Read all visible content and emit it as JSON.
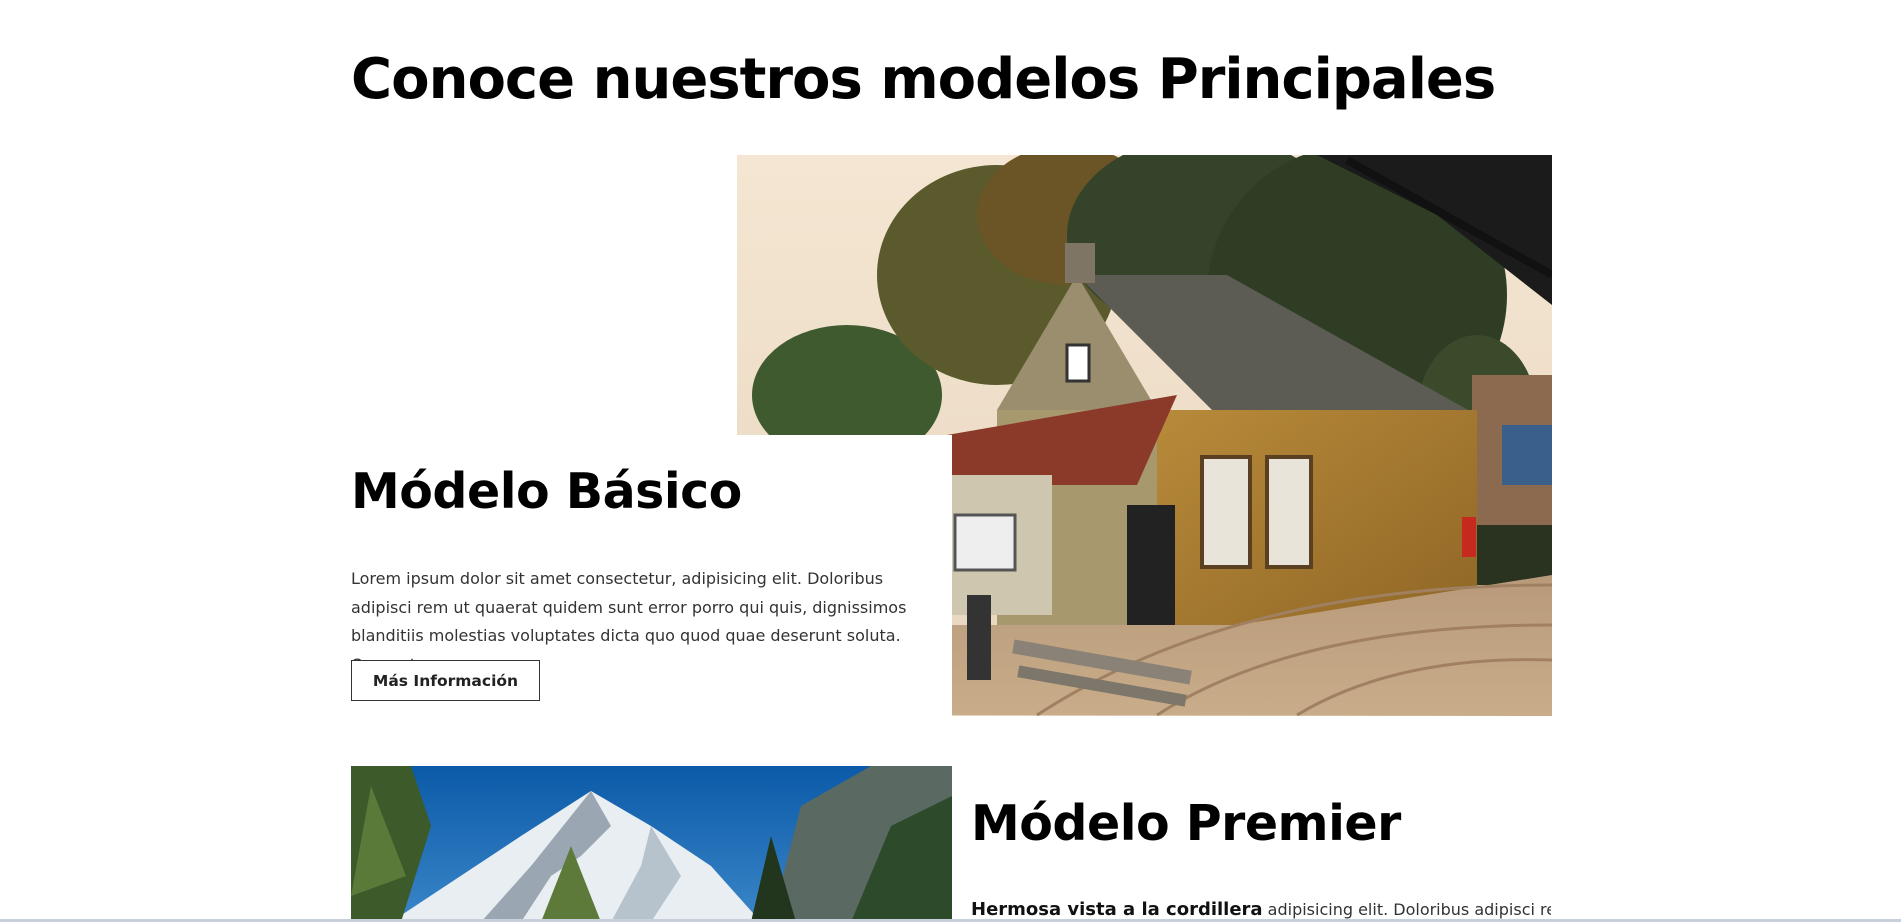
{
  "page": {
    "title": "Conoce nuestros modelos Principales"
  },
  "models": [
    {
      "title": "Módelo Básico",
      "description": "Lorem ipsum dolor sit amet consectetur, adipisicing elit. Doloribus adipisci rem ut quaerat quidem sunt error porro qui quis, dignissimos blanditiis molestias voluptates dicta quo quod quae deserunt soluta. Quaerat",
      "button_label": "Más Información"
    },
    {
      "title": "Módelo Premier",
      "description_bold": "Hermosa vista a la cordillera",
      "description_rest": " adipisicing elit. Doloribus adipisci rem"
    }
  ]
}
